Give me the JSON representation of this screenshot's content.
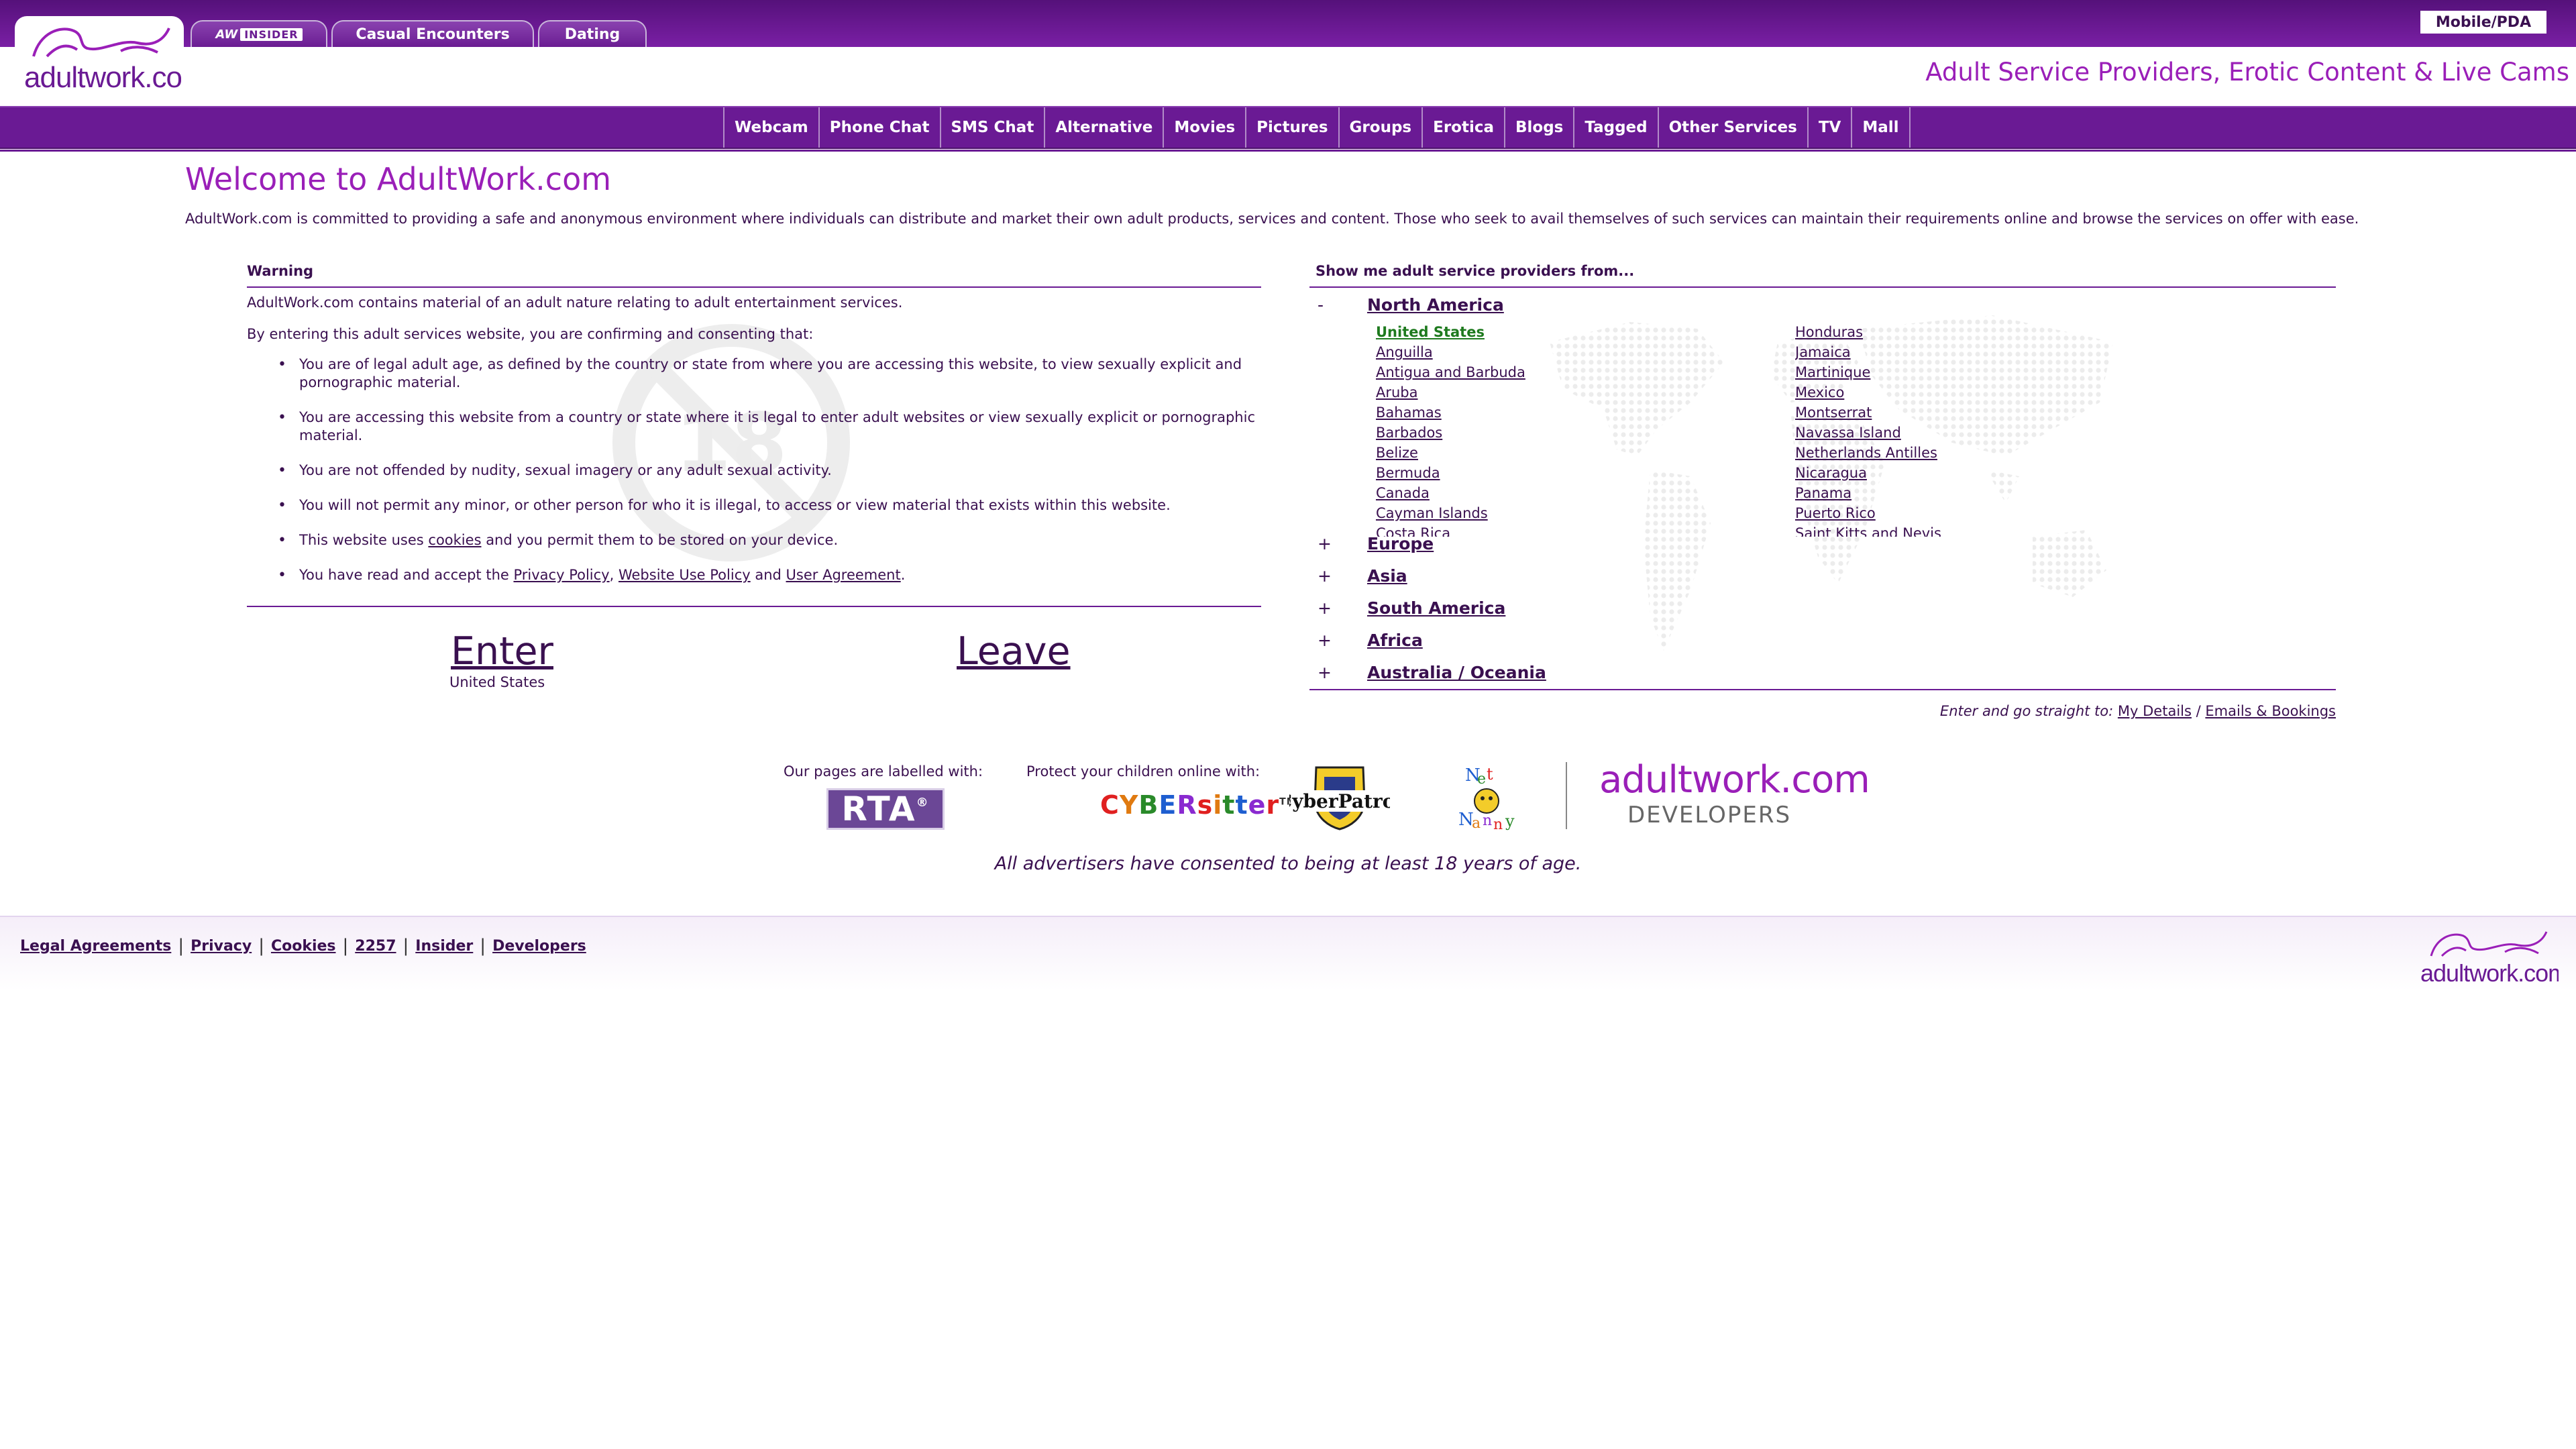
{
  "header": {
    "logo_text": "adultwork.com",
    "tabs": [
      {
        "badge_aw": "AW",
        "badge_insider": "INSIDER"
      },
      {
        "label": "Casual Encounters"
      },
      {
        "label": "Dating"
      }
    ],
    "mobile_label": "Mobile/PDA",
    "tagline": "Adult Service Providers, Erotic Content & Live Cams"
  },
  "nav": [
    "Webcam",
    "Phone Chat",
    "SMS Chat",
    "Alternative",
    "Movies",
    "Pictures",
    "Groups",
    "Erotica",
    "Blogs",
    "Tagged",
    "Other Services",
    "TV",
    "Mall"
  ],
  "welcome": {
    "title": "Welcome to AdultWork.com",
    "intro": "AdultWork.com is committed to providing a safe and anonymous environment where individuals can distribute and market their own adult products, services and content. Those who seek to avail themselves of such services can maintain their requirements online and browse the services on offer with ease."
  },
  "warning": {
    "heading": "Warning",
    "text1": "AdultWork.com contains material of an adult nature relating to adult entertainment services.",
    "text2": "By entering this adult services website, you are confirming and consenting that:",
    "bullets": [
      "You are of legal adult age, as defined by the country or state from where you are accessing this website, to view sexually explicit and pornographic material.",
      "You are accessing this website from a country or state where it is legal to enter adult websites or view sexually explicit or pornographic material.",
      "You are not offended by nudity, sexual imagery or any adult sexual activity.",
      "You will not permit any minor, or other person for who it is illegal, to access or view material that exists within this website."
    ],
    "cookies": {
      "pre": "This website uses ",
      "link": "cookies",
      "post": " and you permit them to be stored on your device."
    },
    "policies": {
      "pre": "You have read and accept the ",
      "privacy": "Privacy Policy",
      "comma": ", ",
      "website": "Website Use Policy",
      "and": " and ",
      "agreement": "User Agreement",
      "end": "."
    },
    "enter_label": "Enter",
    "enter_sub": "United States",
    "leave_label": "Leave"
  },
  "regions": {
    "heading": "Show me adult service providers from...",
    "expanded": {
      "sign": "-",
      "name": "North America"
    },
    "countries_col1": [
      "United States",
      "Anguilla",
      "Antigua and Barbuda",
      "Aruba",
      "Bahamas",
      "Barbados",
      "Belize",
      "Bermuda",
      "Canada",
      "Cayman Islands",
      "Costa Rica"
    ],
    "countries_col2": [
      "Honduras",
      "Jamaica",
      "Martinique",
      "Mexico",
      "Montserrat",
      "Navassa Island",
      "Netherlands Antilles",
      "Nicaragua",
      "Panama",
      "Puerto Rico",
      "Saint Kitts and Nevis"
    ],
    "collapsed": [
      {
        "sign": "+",
        "name": "Europe"
      },
      {
        "sign": "+",
        "name": "Asia"
      },
      {
        "sign": "+",
        "name": "South America"
      },
      {
        "sign": "+",
        "name": "Africa"
      },
      {
        "sign": "+",
        "name": "Australia / Oceania"
      }
    ],
    "straight_pre": "Enter and go straight to:",
    "my_details": "My Details",
    "slash": "/",
    "emails": "Emails & Bookings"
  },
  "labels": {
    "labelled_text": "Our pages are labelled with:",
    "protect_text": "Protect your children online with:",
    "rta": "RTA",
    "rta_reg": "®",
    "cybersitter": [
      "C",
      "Y",
      "B",
      "E",
      "R",
      "s",
      "i",
      "t",
      "t",
      "e",
      "r"
    ],
    "cybersitter_tm": "TM",
    "cyberpatrol": "CyberPatrol",
    "netnanny": [
      "N",
      "e",
      "t",
      "N",
      "a",
      "n",
      "n",
      "y"
    ],
    "dev_title": "adultwork.com",
    "dev_sub": "DEVELOPERS",
    "consent": "All advertisers have consented to being at least 18 years of age."
  },
  "footer": {
    "links": [
      "Legal Agreements",
      "Privacy",
      "Cookies",
      "2257",
      "Insider",
      "Developers"
    ],
    "logo_text": "adultwork.com"
  },
  "colors": {
    "brand_purple": "#6a1a94",
    "accent_magenta": "#9a1fb8",
    "selected_green": "#1e7a1e",
    "text": "#3a1050"
  }
}
